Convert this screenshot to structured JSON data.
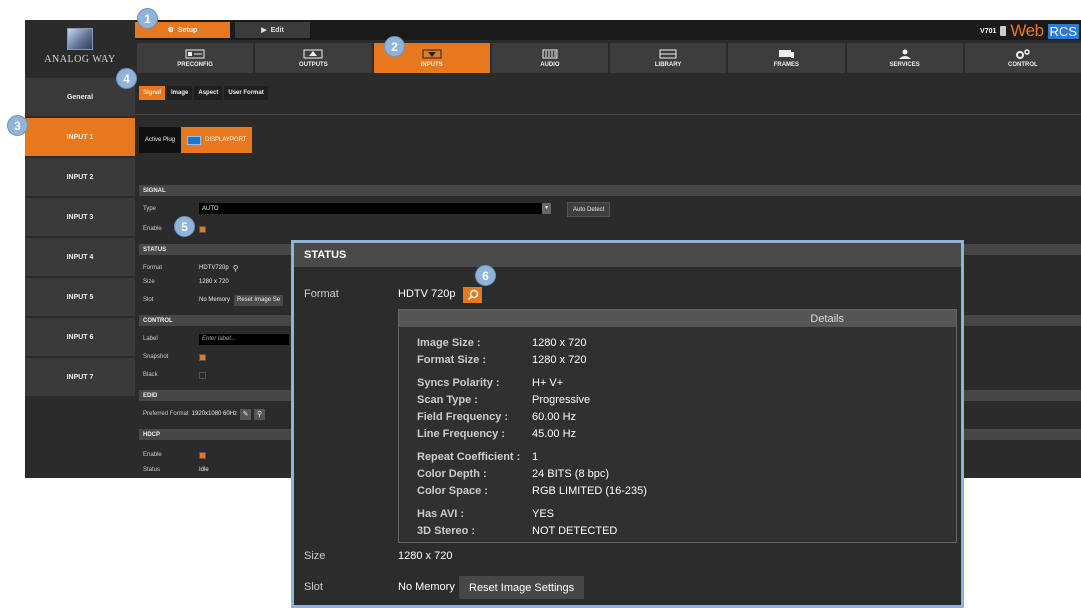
{
  "colors": {
    "accent": "#e8781e",
    "panel": "#2b2b2b",
    "callout": "#8fb3d9",
    "zoom_border": "#8fb3dc"
  },
  "logo": {
    "text": "ANALOG WAY"
  },
  "topbar": {
    "setup_label": "Setup",
    "edit_label": "Edit",
    "version": "V701",
    "brand_web": "Web",
    "brand_rcs": "RCS"
  },
  "nav": [
    {
      "label": "PRECONFIG",
      "icon": "preconfig-icon"
    },
    {
      "label": "OUTPUTS",
      "icon": "outputs-icon"
    },
    {
      "label": "INPUTS",
      "icon": "inputs-icon",
      "active": true
    },
    {
      "label": "AUDIO",
      "icon": "audio-icon"
    },
    {
      "label": "LIBRARY",
      "icon": "library-icon"
    },
    {
      "label": "FRAMES",
      "icon": "frames-icon"
    },
    {
      "label": "SERVICES",
      "icon": "services-icon"
    },
    {
      "label": "CONTROL",
      "icon": "control-icon"
    }
  ],
  "sidebar": {
    "items": [
      {
        "label": "General"
      },
      {
        "label": "INPUT 1",
        "active": true
      },
      {
        "label": "INPUT 2"
      },
      {
        "label": "INPUT 3"
      },
      {
        "label": "INPUT 4"
      },
      {
        "label": "INPUT 5"
      },
      {
        "label": "INPUT 6"
      },
      {
        "label": "INPUT 7"
      }
    ]
  },
  "subtabs": [
    {
      "label": "Signal",
      "active": true
    },
    {
      "label": "Image"
    },
    {
      "label": "Aspect"
    },
    {
      "label": "User Format"
    }
  ],
  "active_plug": {
    "label": "Active Plug",
    "value": "DISPLAYPORT"
  },
  "signal": {
    "header": "SIGNAL",
    "type_label": "Type",
    "type_value": "AUTO",
    "auto_detect": "Auto Detect",
    "enable_label": "Enable",
    "enable_checked": true
  },
  "status": {
    "header": "STATUS",
    "format_label": "Format",
    "format_value": "HDTV720p",
    "size_label": "Size",
    "size_value": "1280 x 720",
    "slot_label": "Slot",
    "slot_value": "No Memory",
    "reset_label": "Reset Image Se"
  },
  "control": {
    "header": "CONTROL",
    "label_label": "Label",
    "label_placeholder": "Enter label...",
    "snapshot_label": "Snapshot",
    "snapshot_checked": true,
    "black_label": "Black",
    "black_checked": false
  },
  "edid": {
    "header": "EDID",
    "preferred_label": "Preferred Format",
    "preferred_value": "1920x1080 60Hz"
  },
  "hdcp": {
    "header": "HDCP",
    "enable_label": "Enable",
    "enable_checked": true,
    "status_label": "Status",
    "status_value": "Idle"
  },
  "zoom": {
    "header": "STATUS",
    "format_label": "Format",
    "format_value": "HDTV 720p",
    "details_header": "Details",
    "details": [
      {
        "k": "Image Size :",
        "v": "1280 x 720"
      },
      {
        "k": "Format Size :",
        "v": "1280 x 720"
      },
      {
        "k": "Syncs Polarity :",
        "v": "H+ V+"
      },
      {
        "k": "Scan Type :",
        "v": "Progressive"
      },
      {
        "k": "Field Frequency :",
        "v": "60.00 Hz"
      },
      {
        "k": "Line Frequency :",
        "v": "45.00 Hz"
      },
      {
        "k": "Repeat Coefficient :",
        "v": "1"
      },
      {
        "k": "Color Depth :",
        "v": "24 BITS (8 bpc)"
      },
      {
        "k": "Color Space :",
        "v": "RGB LIMITED (16-235)"
      },
      {
        "k": "Has AVI :",
        "v": "YES"
      },
      {
        "k": "3D Stereo :",
        "v": "NOT DETECTED"
      }
    ],
    "size_label": "Size",
    "size_value": "1280 x 720",
    "slot_label": "Slot",
    "slot_value": "No Memory",
    "reset_label": "Reset Image Settings"
  },
  "callouts": [
    "1",
    "2",
    "3",
    "4",
    "5",
    "6"
  ]
}
